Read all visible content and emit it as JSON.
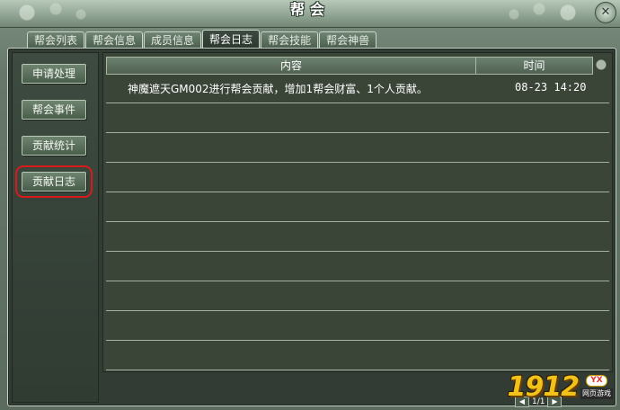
{
  "window": {
    "title": "帮会",
    "close_symbol": "✕"
  },
  "tabs": [
    {
      "label": "帮会列表"
    },
    {
      "label": "帮会信息"
    },
    {
      "label": "成员信息"
    },
    {
      "label": "帮会日志",
      "active": true
    },
    {
      "label": "帮会技能"
    },
    {
      "label": "帮会神兽"
    }
  ],
  "sidebar": {
    "buttons": [
      {
        "label": "申请处理"
      },
      {
        "label": "帮会事件"
      },
      {
        "label": "贡献统计"
      },
      {
        "label": "贡献日志",
        "selected": true
      }
    ]
  },
  "log": {
    "columns": {
      "content": "内容",
      "time": "时间"
    },
    "rows": [
      {
        "content": "神魔遮天GM002进行帮会贡献，增加1帮会财富、1个人贡献。",
        "time": "08-23 14:20"
      }
    ]
  },
  "pager": {
    "prev": "◀",
    "page": "1/1",
    "next": "▶"
  },
  "watermark": {
    "number": "1912",
    "badge": "YX",
    "label": "网页游戏"
  },
  "colors": {
    "highlight_box": "#d81a1a",
    "panel_bg": "#323c34",
    "text": "#ffffff",
    "watermark": "#f1c21a"
  }
}
